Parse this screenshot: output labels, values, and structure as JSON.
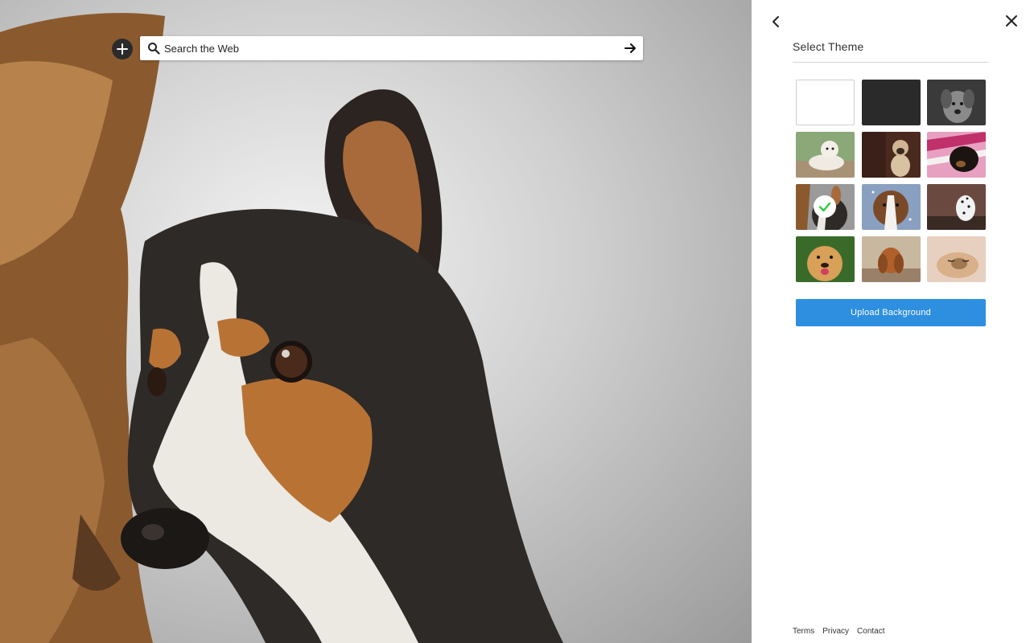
{
  "search": {
    "placeholder": "Search the Web"
  },
  "panel": {
    "title": "Select Theme",
    "upload_label": "Upload Background",
    "selected_index": 6,
    "themes": [
      {
        "kind": "solid",
        "color": "#ffffff"
      },
      {
        "kind": "solid",
        "color": "#2a2a2a"
      },
      {
        "kind": "photo",
        "subject": "grey puppy"
      },
      {
        "kind": "photo",
        "subject": "labrador puppy"
      },
      {
        "kind": "photo",
        "subject": "pug"
      },
      {
        "kind": "photo",
        "subject": "black puppy on pink"
      },
      {
        "kind": "photo",
        "subject": "two dogs"
      },
      {
        "kind": "photo",
        "subject": "saint bernard in snow"
      },
      {
        "kind": "photo",
        "subject": "dalmatian"
      },
      {
        "kind": "photo",
        "subject": "golden retriever"
      },
      {
        "kind": "photo",
        "subject": "cocker spaniel"
      },
      {
        "kind": "photo",
        "subject": "sleeping puppy"
      }
    ]
  },
  "footer": {
    "terms": "Terms",
    "privacy": "Privacy",
    "contact": "Contact"
  },
  "colors": {
    "accent": "#2e8fe0",
    "check": "#2ecc40"
  }
}
